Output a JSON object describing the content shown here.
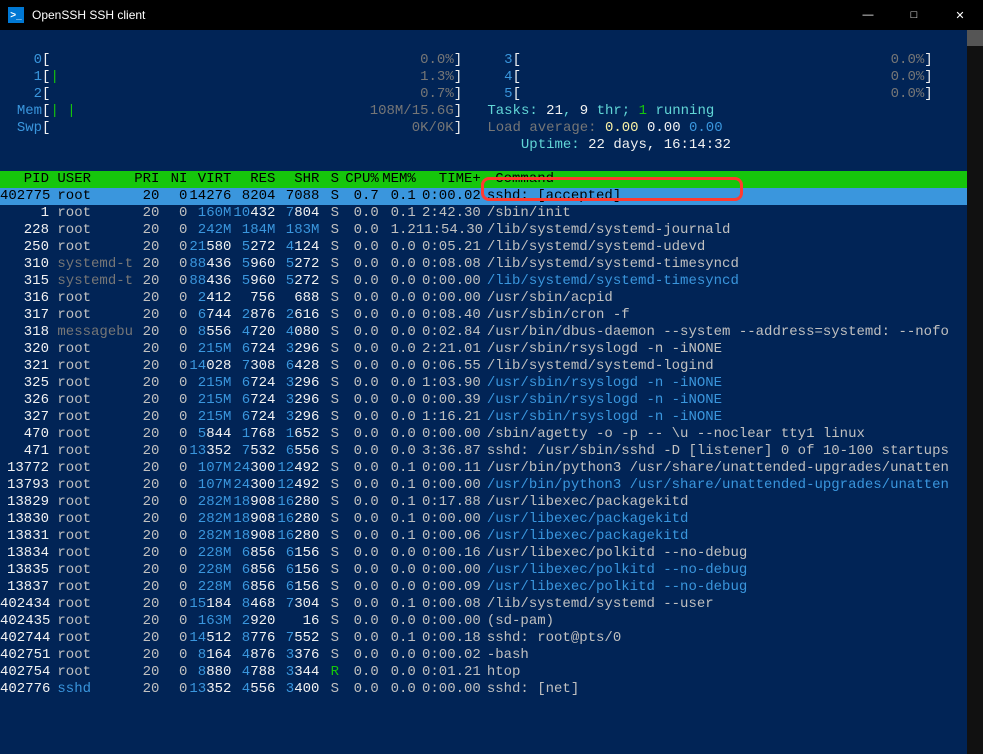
{
  "window": {
    "title": "OpenSSH SSH client"
  },
  "meters": {
    "cpu": [
      {
        "id": "0",
        "bar": "",
        "pct": "0.0%"
      },
      {
        "id": "1",
        "bar": "|",
        "pct": "1.3%"
      },
      {
        "id": "2",
        "bar": "",
        "pct": "0.7%"
      },
      {
        "id": "3",
        "bar": "",
        "pct": "0.0%"
      },
      {
        "id": "4",
        "bar": "",
        "pct": "0.0%"
      },
      {
        "id": "5",
        "bar": "",
        "pct": "0.0%"
      }
    ],
    "mem": {
      "label": "Mem",
      "bar": "| |",
      "val": "108M/15.6G"
    },
    "swp": {
      "label": "Swp",
      "bar": "",
      "val": "0K/0K"
    },
    "tasks": {
      "label": "Tasks:",
      "total": "21",
      "thr": "9",
      "running": "1",
      "tail": "running"
    },
    "load": {
      "label": "Load average:",
      "v1": "0.00",
      "v2": "0.00",
      "v3": "0.00"
    },
    "uptime": {
      "label": "Uptime:",
      "val": "22 days, 16:14:32"
    }
  },
  "header": {
    "pid": "PID",
    "user": "USER",
    "pri": "PRI",
    "ni": "NI",
    "virt": "VIRT",
    "res": "RES",
    "shr": "SHR",
    "s": "S",
    "cpu": "CPU%",
    "mem": "MEM%",
    "time": "TIME+",
    "cmd": "Command"
  },
  "rows": [
    {
      "pid": "402775",
      "user": "root",
      "usercls": "",
      "pri": "20",
      "ni": "0",
      "virt": "14276",
      "virtcls": "",
      "res": "8204",
      "shr": "7088",
      "s": "S",
      "cpu": "0.7",
      "mem": "0.1",
      "time": "0:00.02",
      "cmd": "sshd: [accepted]",
      "rowcls": "sel"
    },
    {
      "pid": "1",
      "user": "root",
      "pri": "20",
      "ni": "0",
      "virt": "160M",
      "virtcls": "cyan",
      "res": "10432",
      "shr": "7804",
      "s": "S",
      "cpu": "0.0",
      "mem": "0.1",
      "time": "2:42.30",
      "cmd": "/sbin/init"
    },
    {
      "pid": "228",
      "user": "root",
      "pri": "20",
      "ni": "0",
      "virt": "242M",
      "virtcls": "cyan",
      "res": "184M",
      "rescls": "cyan",
      "shr": "183M",
      "shrcls": "cyan",
      "s": "S",
      "cpu": "0.0",
      "mem": "1.2",
      "time": "11:54.30",
      "cmd": "/lib/systemd/systemd-journald"
    },
    {
      "pid": "250",
      "user": "root",
      "pri": "20",
      "ni": "0",
      "virt": "21580",
      "virtcls": "",
      "res": "5272",
      "shr": "4124",
      "s": "S",
      "cpu": "0.0",
      "mem": "0.0",
      "time": "0:05.21",
      "cmd": "/lib/systemd/systemd-udevd"
    },
    {
      "pid": "310",
      "user": "systemd-t",
      "usercls": "grey",
      "pri": "20",
      "ni": "0",
      "virt": "88436",
      "res": "5960",
      "shr": "5272",
      "s": "S",
      "cpu": "0.0",
      "mem": "0.0",
      "time": "0:08.08",
      "cmd": "/lib/systemd/systemd-timesyncd"
    },
    {
      "pid": "315",
      "user": "systemd-t",
      "usercls": "grey",
      "pri": "20",
      "ni": "0",
      "virt": "88436",
      "res": "5960",
      "shr": "5272",
      "s": "S",
      "cpu": "0.0",
      "mem": "0.0",
      "time": "0:00.00",
      "cmd": "/lib/systemd/systemd-timesyncd",
      "cmdcls": "cyan"
    },
    {
      "pid": "316",
      "user": "root",
      "pri": "20",
      "ni": "0",
      "virt": "2412",
      "res": "756",
      "shr": "688",
      "s": "S",
      "cpu": "0.0",
      "mem": "0.0",
      "time": "0:00.00",
      "cmd": "/usr/sbin/acpid"
    },
    {
      "pid": "317",
      "user": "root",
      "pri": "20",
      "ni": "0",
      "virt": "6744",
      "res": "2876",
      "shr": "2616",
      "s": "S",
      "cpu": "0.0",
      "mem": "0.0",
      "time": "0:08.40",
      "cmd": "/usr/sbin/cron -f"
    },
    {
      "pid": "318",
      "user": "messagebu",
      "usercls": "grey",
      "pri": "20",
      "ni": "0",
      "virt": "8556",
      "res": "4720",
      "shr": "4080",
      "s": "S",
      "cpu": "0.0",
      "mem": "0.0",
      "time": "0:02.84",
      "cmd": "/usr/bin/dbus-daemon --system --address=systemd: --nofo"
    },
    {
      "pid": "320",
      "user": "root",
      "pri": "20",
      "ni": "0",
      "virt": "215M",
      "virtcls": "cyan",
      "res": "6724",
      "shr": "3296",
      "s": "S",
      "cpu": "0.0",
      "mem": "0.0",
      "time": "2:21.01",
      "cmd": "/usr/sbin/rsyslogd -n -iNONE"
    },
    {
      "pid": "321",
      "user": "root",
      "pri": "20",
      "ni": "0",
      "virt": "14028",
      "res": "7308",
      "shr": "6428",
      "s": "S",
      "cpu": "0.0",
      "mem": "0.0",
      "time": "0:06.55",
      "cmd": "/lib/systemd/systemd-logind"
    },
    {
      "pid": "325",
      "user": "root",
      "pri": "20",
      "ni": "0",
      "virt": "215M",
      "virtcls": "cyan",
      "res": "6724",
      "shr": "3296",
      "s": "S",
      "cpu": "0.0",
      "mem": "0.0",
      "time": "1:03.90",
      "cmd": "/usr/sbin/rsyslogd -n -iNONE",
      "cmdcls": "cyan"
    },
    {
      "pid": "326",
      "user": "root",
      "pri": "20",
      "ni": "0",
      "virt": "215M",
      "virtcls": "cyan",
      "res": "6724",
      "shr": "3296",
      "s": "S",
      "cpu": "0.0",
      "mem": "0.0",
      "time": "0:00.39",
      "cmd": "/usr/sbin/rsyslogd -n -iNONE",
      "cmdcls": "cyan"
    },
    {
      "pid": "327",
      "user": "root",
      "pri": "20",
      "ni": "0",
      "virt": "215M",
      "virtcls": "cyan",
      "res": "6724",
      "shr": "3296",
      "s": "S",
      "cpu": "0.0",
      "mem": "0.0",
      "time": "1:16.21",
      "cmd": "/usr/sbin/rsyslogd -n -iNONE",
      "cmdcls": "cyan"
    },
    {
      "pid": "470",
      "user": "root",
      "pri": "20",
      "ni": "0",
      "virt": "5844",
      "res": "1768",
      "shr": "1652",
      "s": "S",
      "cpu": "0.0",
      "mem": "0.0",
      "time": "0:00.00",
      "cmd": "/sbin/agetty -o -p -- \\u --noclear tty1 linux"
    },
    {
      "pid": "471",
      "user": "root",
      "pri": "20",
      "ni": "0",
      "virt": "13352",
      "res": "7532",
      "shr": "6556",
      "s": "S",
      "cpu": "0.0",
      "mem": "0.0",
      "time": "3:36.87",
      "cmd": "sshd: /usr/sbin/sshd -D [listener] 0 of 10-100 startups"
    },
    {
      "pid": "13772",
      "user": "root",
      "pri": "20",
      "ni": "0",
      "virt": "107M",
      "virtcls": "cyan",
      "res": "24300",
      "shr": "12492",
      "s": "S",
      "cpu": "0.0",
      "mem": "0.1",
      "time": "0:00.11",
      "cmd": "/usr/bin/python3 /usr/share/unattended-upgrades/unatten"
    },
    {
      "pid": "13793",
      "user": "root",
      "pri": "20",
      "ni": "0",
      "virt": "107M",
      "virtcls": "cyan",
      "res": "24300",
      "shr": "12492",
      "s": "S",
      "cpu": "0.0",
      "mem": "0.1",
      "time": "0:00.00",
      "cmd": "/usr/bin/python3 /usr/share/unattended-upgrades/unatten",
      "cmdcls": "cyan"
    },
    {
      "pid": "13829",
      "user": "root",
      "pri": "20",
      "ni": "0",
      "virt": "282M",
      "virtcls": "cyan",
      "res": "18908",
      "shr": "16280",
      "s": "S",
      "cpu": "0.0",
      "mem": "0.1",
      "time": "0:17.88",
      "cmd": "/usr/libexec/packagekitd"
    },
    {
      "pid": "13830",
      "user": "root",
      "pri": "20",
      "ni": "0",
      "virt": "282M",
      "virtcls": "cyan",
      "res": "18908",
      "shr": "16280",
      "s": "S",
      "cpu": "0.0",
      "mem": "0.1",
      "time": "0:00.00",
      "cmd": "/usr/libexec/packagekitd",
      "cmdcls": "cyan"
    },
    {
      "pid": "13831",
      "user": "root",
      "pri": "20",
      "ni": "0",
      "virt": "282M",
      "virtcls": "cyan",
      "res": "18908",
      "shr": "16280",
      "s": "S",
      "cpu": "0.0",
      "mem": "0.1",
      "time": "0:00.06",
      "cmd": "/usr/libexec/packagekitd",
      "cmdcls": "cyan"
    },
    {
      "pid": "13834",
      "user": "root",
      "pri": "20",
      "ni": "0",
      "virt": "228M",
      "virtcls": "cyan",
      "res": "6856",
      "shr": "6156",
      "s": "S",
      "cpu": "0.0",
      "mem": "0.0",
      "time": "0:00.16",
      "cmd": "/usr/libexec/polkitd --no-debug"
    },
    {
      "pid": "13835",
      "user": "root",
      "pri": "20",
      "ni": "0",
      "virt": "228M",
      "virtcls": "cyan",
      "res": "6856",
      "shr": "6156",
      "s": "S",
      "cpu": "0.0",
      "mem": "0.0",
      "time": "0:00.00",
      "cmd": "/usr/libexec/polkitd --no-debug",
      "cmdcls": "cyan"
    },
    {
      "pid": "13837",
      "user": "root",
      "pri": "20",
      "ni": "0",
      "virt": "228M",
      "virtcls": "cyan",
      "res": "6856",
      "shr": "6156",
      "s": "S",
      "cpu": "0.0",
      "mem": "0.0",
      "time": "0:00.09",
      "cmd": "/usr/libexec/polkitd --no-debug",
      "cmdcls": "cyan"
    },
    {
      "pid": "402434",
      "user": "root",
      "pri": "20",
      "ni": "0",
      "virt": "15184",
      "res": "8468",
      "shr": "7304",
      "s": "S",
      "cpu": "0.0",
      "mem": "0.1",
      "time": "0:00.08",
      "cmd": "/lib/systemd/systemd --user"
    },
    {
      "pid": "402435",
      "user": "root",
      "pri": "20",
      "ni": "0",
      "virt": "163M",
      "virtcls": "cyan",
      "res": "2920",
      "shr": "16",
      "s": "S",
      "cpu": "0.0",
      "mem": "0.0",
      "time": "0:00.00",
      "cmd": "(sd-pam)"
    },
    {
      "pid": "402744",
      "user": "root",
      "pri": "20",
      "ni": "0",
      "virt": "14512",
      "res": "8776",
      "shr": "7552",
      "s": "S",
      "cpu": "0.0",
      "mem": "0.1",
      "time": "0:00.18",
      "cmd": "sshd: root@pts/0"
    },
    {
      "pid": "402751",
      "user": "root",
      "pri": "20",
      "ni": "0",
      "virt": "8164",
      "res": "4876",
      "shr": "3376",
      "s": "S",
      "cpu": "0.0",
      "mem": "0.0",
      "time": "0:00.02",
      "cmd": "-bash"
    },
    {
      "pid": "402754",
      "user": "root",
      "pri": "20",
      "ni": "0",
      "virt": "8880",
      "res": "4788",
      "shr": "3344",
      "s": "R",
      "scls": "bgreen",
      "cpu": "0.0",
      "mem": "0.0",
      "time": "0:01.21",
      "cmd": "htop"
    },
    {
      "pid": "402776",
      "user": "sshd",
      "usercls": "cyan",
      "pri": "20",
      "ni": "0",
      "virt": "13352",
      "res": "4556",
      "shr": "3400",
      "s": "S",
      "cpu": "0.0",
      "mem": "0.0",
      "time": "0:00.00",
      "cmd": "sshd: [net]"
    }
  ]
}
